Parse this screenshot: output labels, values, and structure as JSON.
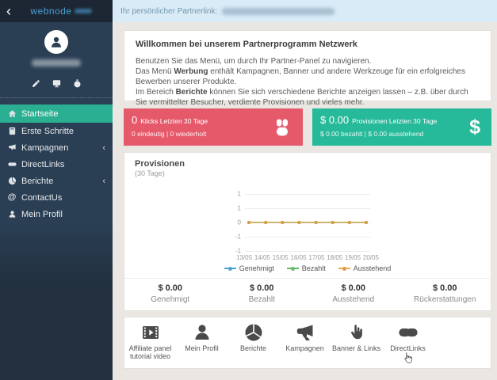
{
  "brand": {
    "logo": "webnode"
  },
  "topbar": {
    "partner_link_label": "Ihr persönlicher Partnerlink:"
  },
  "sidebar": {
    "back_chevron": "‹",
    "profile_actions": [
      {
        "icon": "pencil-icon"
      },
      {
        "icon": "monitor-icon"
      },
      {
        "icon": "stopwatch-icon"
      }
    ],
    "menu": [
      {
        "label": "Startseite",
        "icon": "home-icon",
        "active": true
      },
      {
        "label": "Erste Schritte",
        "icon": "book-icon"
      },
      {
        "label": "Kampagnen",
        "icon": "megaphone-icon",
        "chevron": "‹"
      },
      {
        "label": "DirectLinks",
        "icon": "chain-icon"
      },
      {
        "label": "Berichte",
        "icon": "pie-chart-icon",
        "chevron": "‹"
      },
      {
        "label": "ContactUs",
        "icon": "at-icon",
        "icon_glyph": "@"
      },
      {
        "label": "Mein Profil",
        "icon": "user-icon"
      }
    ]
  },
  "welcome": {
    "title": "Willkommen bei unserem Partnerprogramm Netzwerk",
    "line1": "Benutzen Sie das Menü, um durch Ihr Partner-Panel zu navigieren.",
    "line2_pre": "Das Menü ",
    "line2_bold": "Werbung",
    "line2_post": " enthält Kampagnen, Banner und andere Werkzeuge für ein erfolgreiches Bewerben unserer Produkte.",
    "line3_pre": "Im Bereich ",
    "line3_bold": "Berichte",
    "line3_post": " können Sie sich verschiedene Berichte anzeigen lassen – z.B. über durch Sie vermittelter Besucher, verdiente Provisionen und vieles mehr."
  },
  "stat_cards": {
    "clicks": {
      "value": "0",
      "label": "Klicks Letzten 30 Tage",
      "sub": "0 eindeutig | 0 wiederholt",
      "color": "#E6596B",
      "icon": "mouse-icon"
    },
    "commissions": {
      "value": "$ 0.00",
      "label": "Provisionen Letzten 30 Tage",
      "sub": "$ 0.00 bezahlt | $ 0.00 ausstehend",
      "color": "#26B99A",
      "icon": "dollar-icon",
      "icon_glyph": "$"
    }
  },
  "chart_data": {
    "type": "line",
    "title": "Provisionen",
    "subtitle": "(30 Tage)",
    "x": [
      "13/05",
      "14/05",
      "15/05",
      "16/05",
      "17/05",
      "18/05",
      "19/05",
      "20/05"
    ],
    "series": [
      {
        "name": "Genehmigt",
        "color": "#52A2D8",
        "values": [
          0,
          0,
          0,
          0,
          0,
          0,
          0,
          0
        ]
      },
      {
        "name": "Bezahlt",
        "color": "#66BB6A",
        "values": [
          0,
          0,
          0,
          0,
          0,
          0,
          0,
          0
        ]
      },
      {
        "name": "Ausstehend",
        "color": "#E8AE5D",
        "dot_color": "#DE9A3E",
        "values": [
          0,
          0,
          0,
          0,
          0,
          0,
          0,
          0
        ]
      }
    ],
    "ylim": [
      -1,
      1
    ],
    "ytick_labels": [
      "1",
      "1",
      "0",
      "-1",
      "-1"
    ],
    "grid": true,
    "legend_position": "bottom"
  },
  "summary": [
    {
      "value": "$ 0.00",
      "label": "Genehmigt"
    },
    {
      "value": "$ 0.00",
      "label": "Bezahlt"
    },
    {
      "value": "$ 0.00",
      "label": "Ausstehend"
    },
    {
      "value": "$ 0.00",
      "label": "Rückerstattungen"
    }
  ],
  "shortcuts": [
    {
      "label": "Affiliate panel tutorial video",
      "icon": "film-icon"
    },
    {
      "label": "Mein Profil",
      "icon": "user-icon"
    },
    {
      "label": "Berichte",
      "icon": "pie-chart-icon"
    },
    {
      "label": "Kampagnen",
      "icon": "megaphone-icon"
    },
    {
      "label": "Banner & Links",
      "icon": "hand-click-icon"
    },
    {
      "label": "DirectLinks",
      "icon": "chain-icon"
    }
  ],
  "colors": {
    "sidebar": "#2A3F54",
    "sidebar_header": "#1C2733",
    "active_menu_green": "#2AAF92",
    "card_red": "#E6596B",
    "card_green": "#26B99A",
    "topbar_blue": "#D8EBF7",
    "brand_blue": "#4A9FD6",
    "content_bg": "#EAE7E3"
  }
}
